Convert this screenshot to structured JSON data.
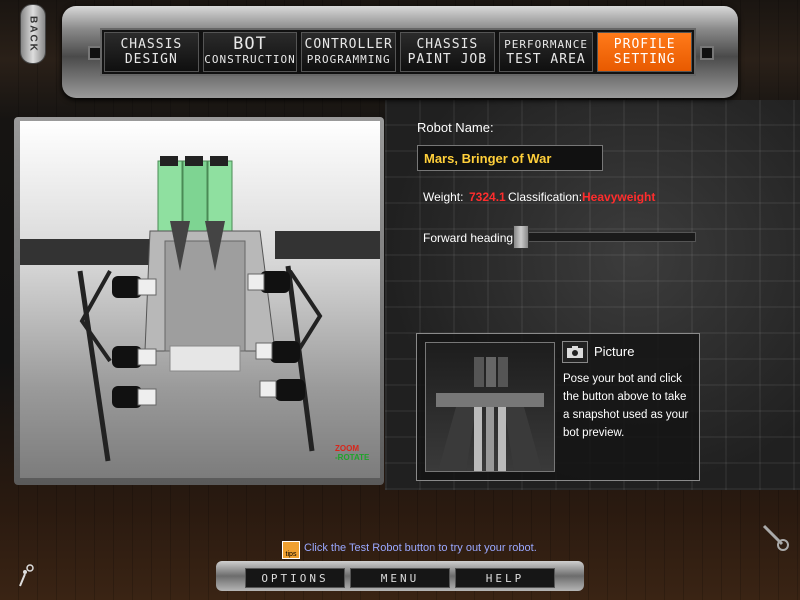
{
  "back_label": "BACK",
  "nav": {
    "tabs": [
      {
        "line1": "CHASSIS",
        "line2": "DESIGN"
      },
      {
        "line1": "BOT",
        "line2": "CONSTRUCTION"
      },
      {
        "line1": "CONTROLLER",
        "line2": "PROGRAMMING"
      },
      {
        "line1": "CHASSIS",
        "line2": "PAINT JOB"
      },
      {
        "line1": "PERFORMANCE",
        "line2": "TEST AREA"
      },
      {
        "line1": "PROFILE",
        "line2": "SETTING"
      }
    ],
    "active_tab": "PROFILE SETTING",
    "active_color": "#ff6a00"
  },
  "viewport": {
    "zoom_label": "ZOOM",
    "rotate_label": "-ROTATE"
  },
  "profile": {
    "name_label": "Robot Name:",
    "name_value": "Mars, Bringer of War",
    "weight_label": "Weight:",
    "weight_value": "7324.1",
    "class_label": "Classification:",
    "class_value": "Heavyweight",
    "heading_label": "Forward heading:",
    "heading_level": 0
  },
  "picture": {
    "title": "Picture",
    "description": "Pose your bot and click the button above to take a snapshot used as your bot preview.",
    "camera_icon": "camera-icon"
  },
  "tip": {
    "icon_text": "tips",
    "text": "Click the Test Robot button to try out your robot."
  },
  "bottom": {
    "options": "OPTIONS",
    "menu": "MENU",
    "help": "HELP"
  },
  "colors": {
    "name_text": "#ffcf3a",
    "stat_red": "#ff2d2d",
    "tip_text": "#9aa8ff"
  }
}
